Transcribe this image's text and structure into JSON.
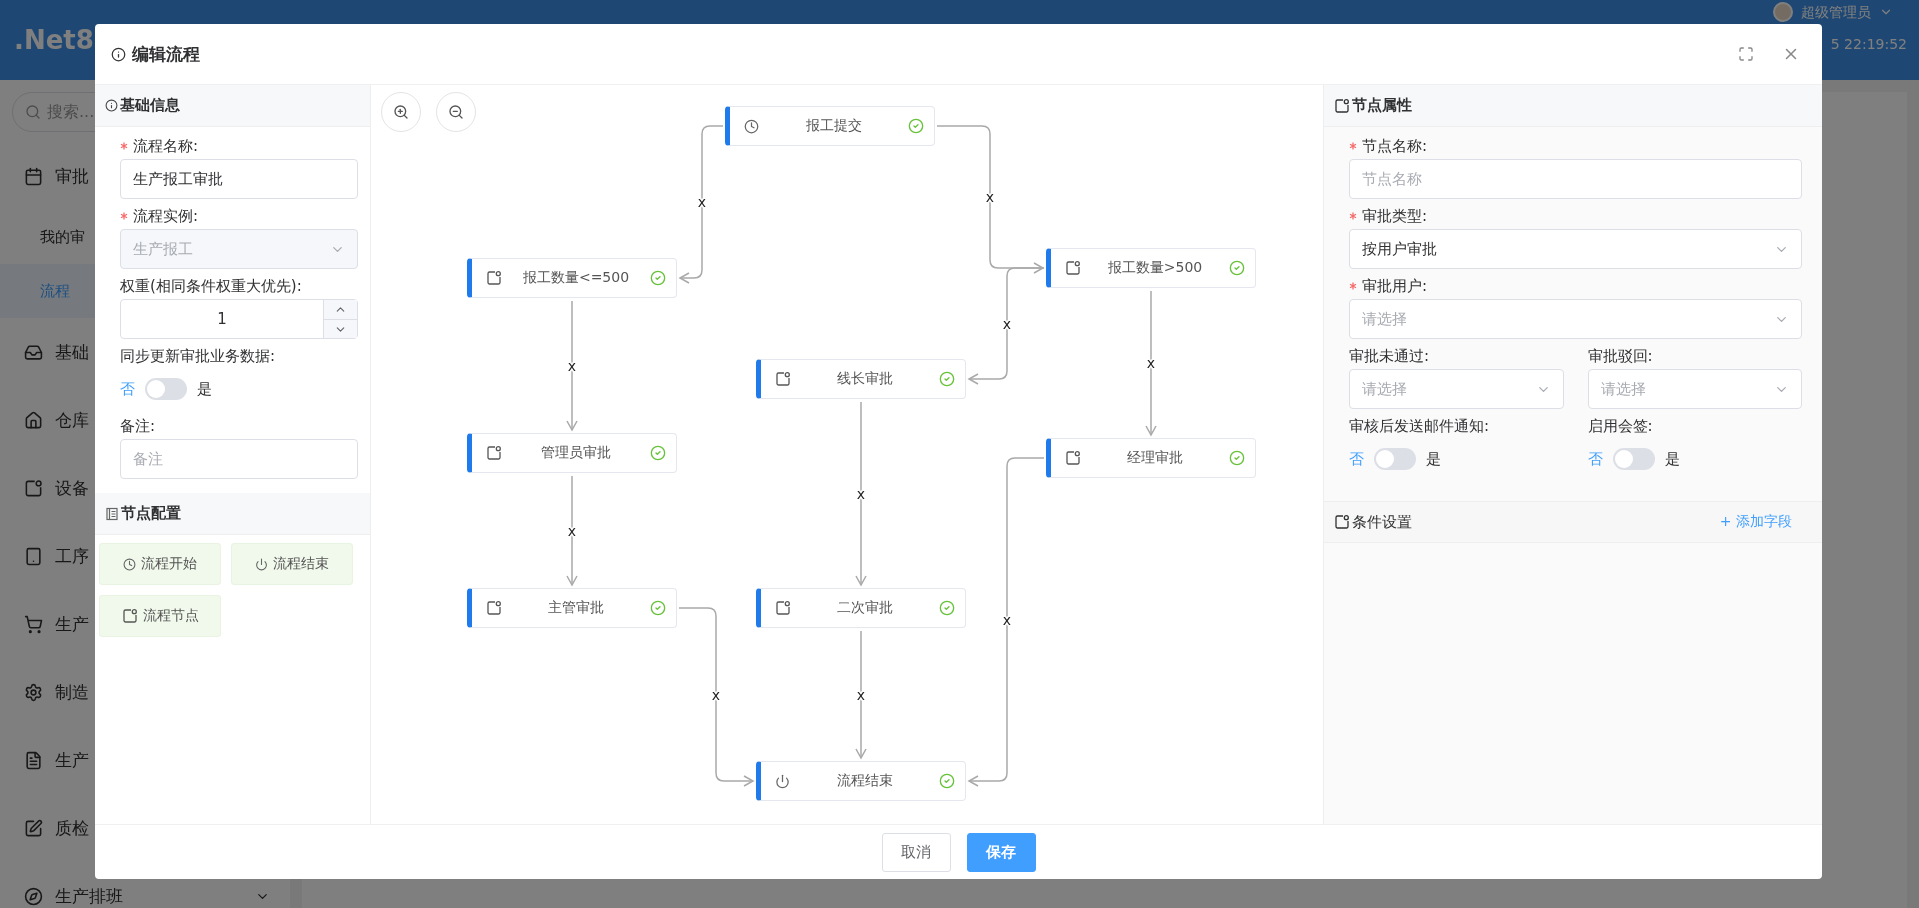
{
  "app": {
    "brand": ".Net8",
    "user": "超级管理员",
    "time": "5 22:19:52",
    "search": {
      "placeholder": "搜索..."
    },
    "menu": [
      {
        "label": "审批",
        "kind": "group",
        "selected": false
      },
      {
        "label": "我的审",
        "kind": "item",
        "selected": false
      },
      {
        "label": "流程",
        "kind": "item",
        "selected": true
      },
      {
        "label": "基础",
        "kind": "group",
        "selected": false
      },
      {
        "label": "仓库",
        "kind": "group",
        "selected": false
      },
      {
        "label": "设备",
        "kind": "group",
        "selected": false
      },
      {
        "label": "工序",
        "kind": "group",
        "selected": false
      },
      {
        "label": "生产",
        "kind": "group",
        "selected": false
      },
      {
        "label": "制造",
        "kind": "group",
        "selected": false
      },
      {
        "label": "生产",
        "kind": "group",
        "selected": false
      },
      {
        "label": "质检",
        "kind": "group",
        "selected": false
      },
      {
        "label": "生产排班",
        "kind": "group",
        "selected": false
      }
    ]
  },
  "dialog": {
    "title": "编辑流程",
    "basic": {
      "title": "基础信息",
      "fields": [
        {
          "label": "流程名称:",
          "kind": "text",
          "required": true,
          "value": "生产报工审批"
        },
        {
          "label": "流程实例:",
          "kind": "select",
          "required": true,
          "value": "生产报工",
          "disabled": true
        },
        {
          "label": "权重(相同条件权重大优先):",
          "kind": "number",
          "required": false,
          "value": "1"
        },
        {
          "label": "同步更新审批业务数据:",
          "kind": "switch",
          "required": false,
          "off_label": "否",
          "on_label": "是",
          "on": false
        },
        {
          "label": "备注:",
          "kind": "text",
          "required": false,
          "placeholder": "备注"
        }
      ]
    },
    "palette": {
      "title": "节点配置",
      "items": [
        {
          "label": "流程开始",
          "kind": "start"
        },
        {
          "label": "流程结束",
          "kind": "end"
        },
        {
          "label": "流程节点",
          "kind": "task"
        }
      ]
    },
    "canvas": {
      "nodes": [
        {
          "label": "报工提交",
          "kind": "start",
          "done": true
        },
        {
          "label": "报工数量<=500",
          "kind": "task",
          "done": true
        },
        {
          "label": "报工数量>500",
          "kind": "task",
          "done": true
        },
        {
          "label": "线长审批",
          "kind": "task",
          "done": true
        },
        {
          "label": "管理员审批",
          "kind": "task",
          "done": true
        },
        {
          "label": "经理审批",
          "kind": "task",
          "done": true
        },
        {
          "label": "主管审批",
          "kind": "task",
          "done": true
        },
        {
          "label": "二次审批",
          "kind": "task",
          "done": true
        },
        {
          "label": "流程结束",
          "kind": "end",
          "done": true
        }
      ],
      "edges": [
        {
          "label": "x"
        },
        {
          "label": "x"
        },
        {
          "label": "x"
        },
        {
          "label": "x"
        },
        {
          "label": "x"
        },
        {
          "label": "x"
        },
        {
          "label": "x"
        },
        {
          "label": "x"
        },
        {
          "label": "x"
        },
        {
          "label": "x"
        }
      ]
    },
    "properties": {
      "title": "节点属性",
      "rows": [
        [
          {
            "label": "节点名称:",
            "kind": "text",
            "required": true,
            "placeholder": "节点名称"
          }
        ],
        [
          {
            "label": "审批类型:",
            "kind": "select",
            "required": true,
            "value": "按用户审批"
          }
        ],
        [
          {
            "label": "审批用户:",
            "kind": "select",
            "required": true,
            "placeholder": "请选择"
          }
        ],
        [
          {
            "label": "审批未通过:",
            "kind": "select",
            "required": false,
            "placeholder": "请选择"
          },
          {
            "label": "审批驳回:",
            "kind": "select",
            "required": false,
            "placeholder": "请选择"
          }
        ],
        [
          {
            "label": "审核后发送邮件通知:",
            "kind": "switch",
            "required": false,
            "off_label": "否",
            "on_label": "是",
            "on": false
          },
          {
            "label": "启用会签:",
            "kind": "switch",
            "required": false,
            "off_label": "否",
            "on_label": "是",
            "on": false
          }
        ]
      ]
    },
    "conditions": {
      "title": "条件设置",
      "action": "+ 添加字段"
    },
    "buttons": [
      {
        "label": "取消",
        "kind": "default"
      },
      {
        "label": "保存",
        "kind": "primary"
      }
    ]
  }
}
